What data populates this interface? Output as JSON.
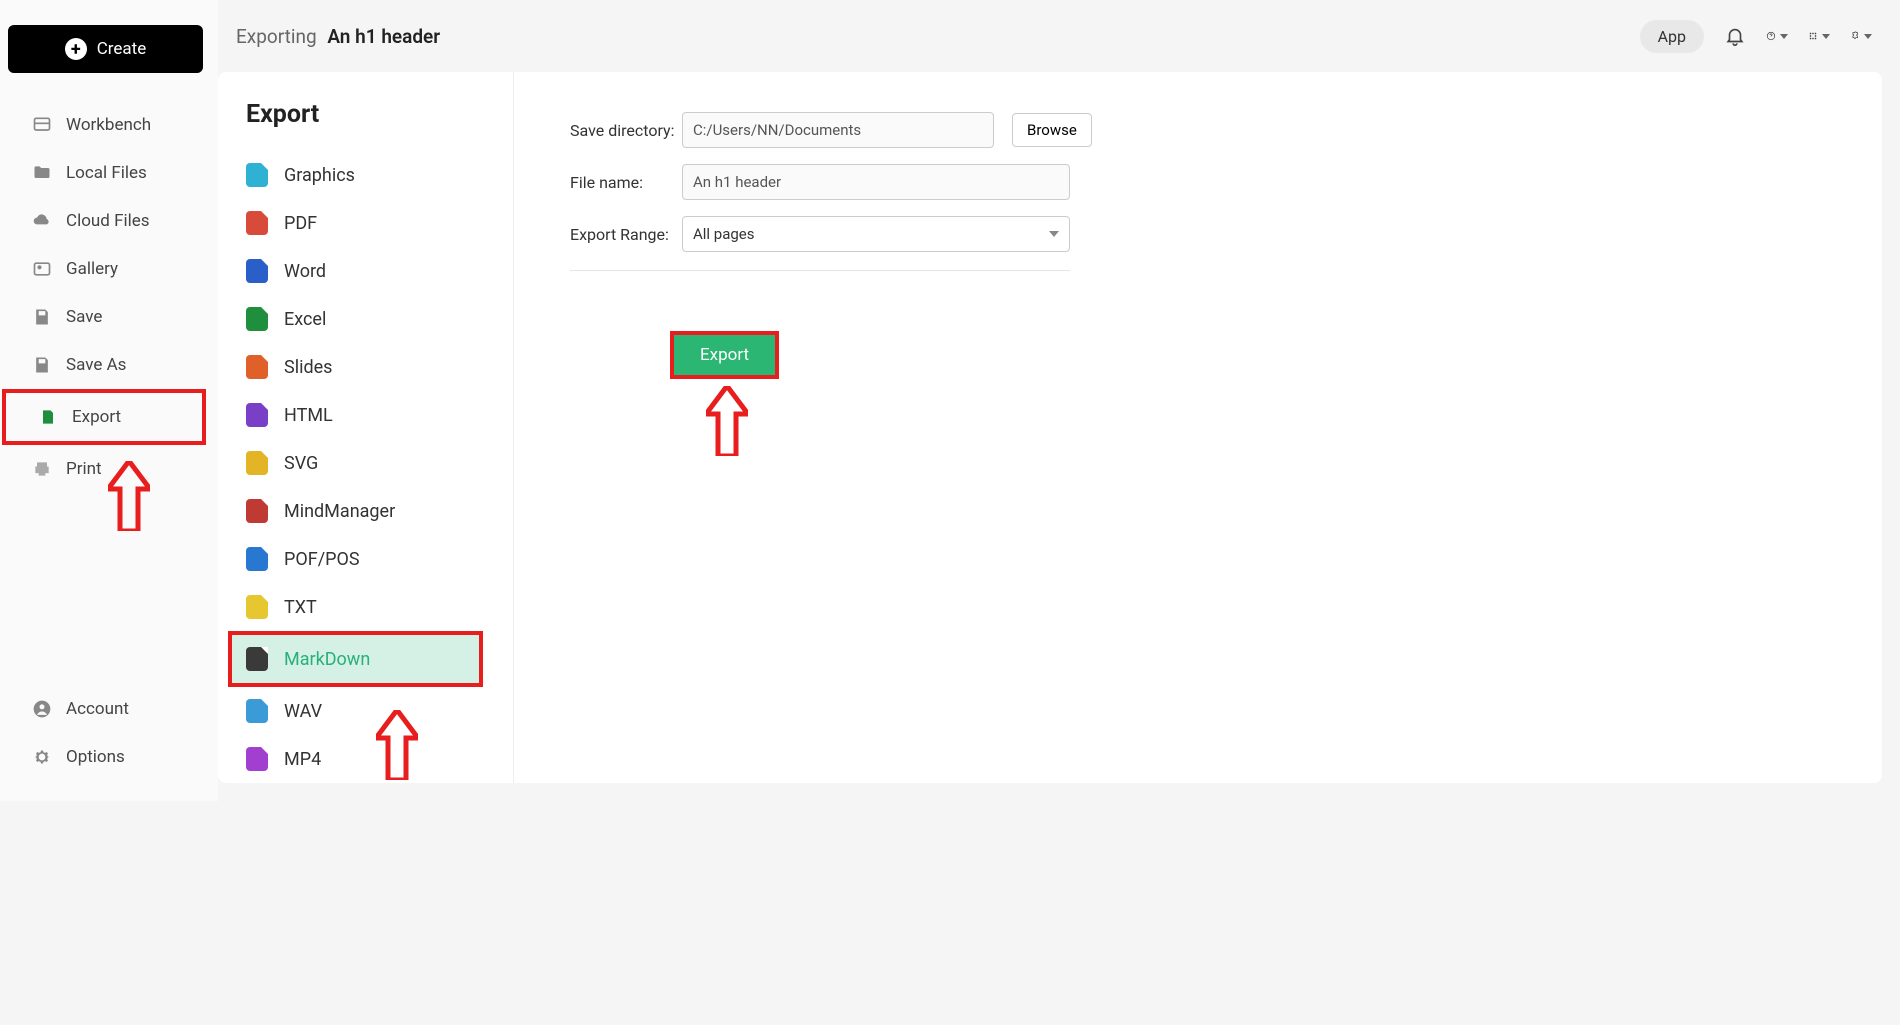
{
  "header": {
    "create_label": "Create",
    "breadcrumb_section": "Exporting",
    "doc_title": "An h1 header",
    "app_label": "App"
  },
  "sidebar": {
    "items": [
      {
        "label": "Workbench",
        "key": "workbench"
      },
      {
        "label": "Local Files",
        "key": "local-files"
      },
      {
        "label": "Cloud Files",
        "key": "cloud-files"
      },
      {
        "label": "Gallery",
        "key": "gallery"
      },
      {
        "label": "Save",
        "key": "save"
      },
      {
        "label": "Save As",
        "key": "save-as"
      },
      {
        "label": "Export",
        "key": "export",
        "highlighted": true
      },
      {
        "label": "Print",
        "key": "print"
      }
    ],
    "bottom": [
      {
        "label": "Account",
        "key": "account"
      },
      {
        "label": "Options",
        "key": "options"
      }
    ]
  },
  "export_panel": {
    "title": "Export",
    "formats": [
      {
        "label": "Graphics",
        "color": "#2fb1d4"
      },
      {
        "label": "PDF",
        "color": "#d84a3a"
      },
      {
        "label": "Word",
        "color": "#2a5ec8"
      },
      {
        "label": "Excel",
        "color": "#1f8f3d"
      },
      {
        "label": "Slides",
        "color": "#e0602a"
      },
      {
        "label": "HTML",
        "color": "#7a3fc7"
      },
      {
        "label": "SVG",
        "color": "#e3b426"
      },
      {
        "label": "MindManager",
        "color": "#c03a34"
      },
      {
        "label": "POF/POS",
        "color": "#2877d1"
      },
      {
        "label": "TXT",
        "color": "#e6c72f"
      },
      {
        "label": "MarkDown",
        "color": "#3a3a3a",
        "selected": true
      },
      {
        "label": "WAV",
        "color": "#3a9bd6"
      },
      {
        "label": "MP4",
        "color": "#a13fd0"
      }
    ]
  },
  "settings": {
    "save_dir_label": "Save directory:",
    "save_dir_value": "C:/Users/NN/Documents",
    "browse_label": "Browse",
    "file_name_label": "File name:",
    "file_name_value": "An h1 header",
    "range_label": "Export Range:",
    "range_value": "All pages",
    "export_button": "Export"
  }
}
